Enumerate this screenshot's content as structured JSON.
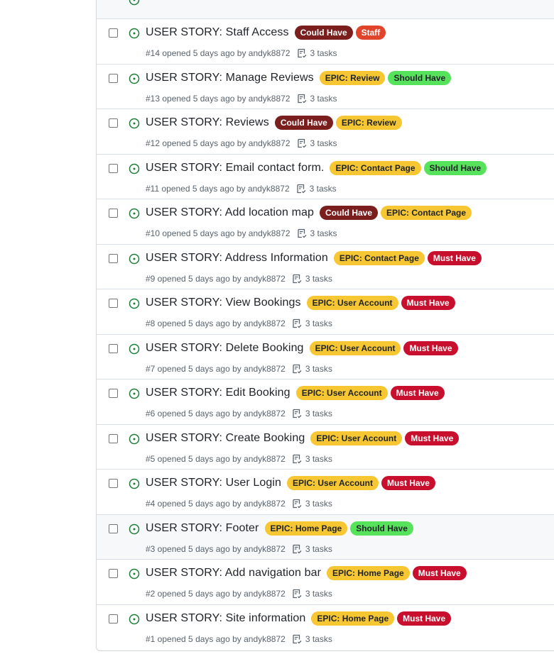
{
  "colors": {
    "open": "#1a7f37",
    "could_have": "#7b1e1e",
    "staff": "#e0452b",
    "epic": "#f6c633",
    "should_have": "#57e25c",
    "must_have": "#c8102e"
  },
  "issues": [
    {
      "title": "USER STORY: Staff Access",
      "meta": "#14 opened 5 days ago by andyk8872",
      "tasks": "3 tasks",
      "labels": [
        {
          "text": "Could Have",
          "bg": "#7b1e1e",
          "fg": "#ffffff"
        },
        {
          "text": "Staff",
          "bg": "#e0452b",
          "fg": "#ffffff"
        }
      ]
    },
    {
      "title": "USER STORY: Manage Reviews",
      "meta": "#13 opened 5 days ago by andyk8872",
      "tasks": "3 tasks",
      "labels": [
        {
          "text": "EPIC: Review",
          "bg": "#f6c633",
          "fg": "#1f2328"
        },
        {
          "text": "Should Have",
          "bg": "#57e25c",
          "fg": "#1f2328"
        }
      ]
    },
    {
      "title": "USER STORY: Reviews",
      "meta": "#12 opened 5 days ago by andyk8872",
      "tasks": "3 tasks",
      "labels": [
        {
          "text": "Could Have",
          "bg": "#7b1e1e",
          "fg": "#ffffff"
        },
        {
          "text": "EPIC: Review",
          "bg": "#f6c633",
          "fg": "#1f2328"
        }
      ]
    },
    {
      "title": "USER STORY: Email contact form.",
      "meta": "#11 opened 5 days ago by andyk8872",
      "tasks": "3 tasks",
      "labels": [
        {
          "text": "EPIC: Contact Page",
          "bg": "#f6c633",
          "fg": "#1f2328"
        },
        {
          "text": "Should Have",
          "bg": "#57e25c",
          "fg": "#1f2328"
        }
      ]
    },
    {
      "title": "USER STORY: Add location map",
      "meta": "#10 opened 5 days ago by andyk8872",
      "tasks": "3 tasks",
      "labels": [
        {
          "text": "Could Have",
          "bg": "#7b1e1e",
          "fg": "#ffffff"
        },
        {
          "text": "EPIC: Contact Page",
          "bg": "#f6c633",
          "fg": "#1f2328"
        }
      ]
    },
    {
      "title": "USER STORY: Address Information",
      "meta": "#9 opened 5 days ago by andyk8872",
      "tasks": "3 tasks",
      "labels": [
        {
          "text": "EPIC: Contact Page",
          "bg": "#f6c633",
          "fg": "#1f2328"
        },
        {
          "text": "Must Have",
          "bg": "#c8102e",
          "fg": "#ffffff"
        }
      ]
    },
    {
      "title": "USER STORY: View Bookings",
      "meta": "#8 opened 5 days ago by andyk8872",
      "tasks": "3 tasks",
      "labels": [
        {
          "text": "EPIC: User Account",
          "bg": "#f6c633",
          "fg": "#1f2328"
        },
        {
          "text": "Must Have",
          "bg": "#c8102e",
          "fg": "#ffffff"
        }
      ]
    },
    {
      "title": "USER STORY: Delete Booking",
      "meta": "#7 opened 5 days ago by andyk8872",
      "tasks": "3 tasks",
      "labels": [
        {
          "text": "EPIC: User Account",
          "bg": "#f6c633",
          "fg": "#1f2328"
        },
        {
          "text": "Must Have",
          "bg": "#c8102e",
          "fg": "#ffffff"
        }
      ]
    },
    {
      "title": "USER STORY: Edit Booking",
      "meta": "#6 opened 5 days ago by andyk8872",
      "tasks": "3 tasks",
      "labels": [
        {
          "text": "EPIC: User Account",
          "bg": "#f6c633",
          "fg": "#1f2328"
        },
        {
          "text": "Must Have",
          "bg": "#c8102e",
          "fg": "#ffffff"
        }
      ]
    },
    {
      "title": "USER STORY: Create Booking",
      "meta": "#5 opened 5 days ago by andyk8872",
      "tasks": "3 tasks",
      "labels": [
        {
          "text": "EPIC: User Account",
          "bg": "#f6c633",
          "fg": "#1f2328"
        },
        {
          "text": "Must Have",
          "bg": "#c8102e",
          "fg": "#ffffff"
        }
      ]
    },
    {
      "title": "USER STORY: User Login",
      "meta": "#4 opened 5 days ago by andyk8872",
      "tasks": "3 tasks",
      "labels": [
        {
          "text": "EPIC: User Account",
          "bg": "#f6c633",
          "fg": "#1f2328"
        },
        {
          "text": "Must Have",
          "bg": "#c8102e",
          "fg": "#ffffff"
        }
      ]
    },
    {
      "title": "USER STORY: Footer",
      "meta": "#3 opened 5 days ago by andyk8872",
      "tasks": "3 tasks",
      "hover": true,
      "labels": [
        {
          "text": "EPIC: Home Page",
          "bg": "#f6c633",
          "fg": "#1f2328"
        },
        {
          "text": "Should Have",
          "bg": "#57e25c",
          "fg": "#1f2328"
        }
      ]
    },
    {
      "title": "USER STORY: Add navigation bar",
      "meta": "#2 opened 5 days ago by andyk8872",
      "tasks": "3 tasks",
      "labels": [
        {
          "text": "EPIC: Home Page",
          "bg": "#f6c633",
          "fg": "#1f2328"
        },
        {
          "text": "Must Have",
          "bg": "#c8102e",
          "fg": "#ffffff"
        }
      ]
    },
    {
      "title": "USER STORY: Site information",
      "meta": "#1 opened 5 days ago by andyk8872",
      "tasks": "3 tasks",
      "labels": [
        {
          "text": "EPIC: Home Page",
          "bg": "#f6c633",
          "fg": "#1f2328"
        },
        {
          "text": "Must Have",
          "bg": "#c8102e",
          "fg": "#ffffff"
        }
      ]
    }
  ]
}
